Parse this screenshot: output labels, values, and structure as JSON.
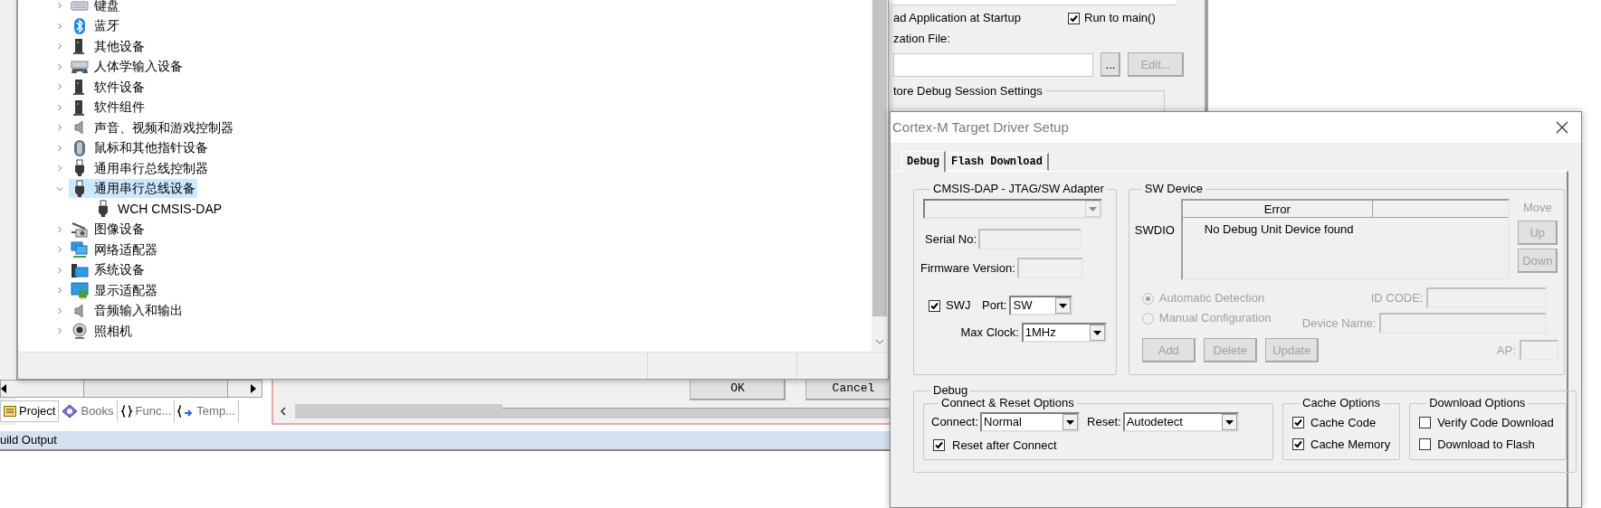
{
  "ide": {
    "project_tabs": [
      {
        "label": "Project",
        "selected": true
      },
      {
        "label": "Books",
        "selected": false
      },
      {
        "label": "Func...",
        "selected": false
      },
      {
        "label": "Temp...",
        "selected": false
      }
    ],
    "build_output": {
      "title": "uild Output"
    }
  },
  "options_dialog": {
    "load_application": {
      "label": "ad Application at Startup"
    },
    "run_to_main": {
      "label": "Run to main()",
      "checked": true
    },
    "init_file": {
      "label": "zation File:"
    },
    "browse_button": {
      "label": "..."
    },
    "edit_button": {
      "label": "Edit...",
      "disabled": true
    },
    "restore_group": {
      "title": "tore Debug Session Settings"
    },
    "buttons": [
      {
        "label": "OK"
      },
      {
        "label": "Cancel"
      }
    ]
  },
  "device_manager": {
    "tree": [
      {
        "label": "键盘",
        "expanded": false,
        "selected": false
      },
      {
        "label": "蓝牙",
        "expanded": false,
        "selected": false
      },
      {
        "label": "其他设备",
        "expanded": false,
        "selected": false
      },
      {
        "label": "人体学输入设备",
        "expanded": false,
        "selected": false
      },
      {
        "label": "软件设备",
        "expanded": false,
        "selected": false
      },
      {
        "label": "软件组件",
        "expanded": false,
        "selected": false
      },
      {
        "label": "声音、视频和游戏控制器",
        "expanded": false,
        "selected": false
      },
      {
        "label": "鼠标和其他指针设备",
        "expanded": false,
        "selected": false
      },
      {
        "label": "通用串行总线控制器",
        "expanded": false,
        "selected": false
      },
      {
        "label": "通用串行总线设备",
        "expanded": true,
        "selected": true,
        "children": [
          {
            "label": "WCH CMSIS-DAP",
            "selected": false
          }
        ]
      },
      {
        "label": "图像设备",
        "expanded": false,
        "selected": false
      },
      {
        "label": "网络适配器",
        "expanded": false,
        "selected": false
      },
      {
        "label": "系统设备",
        "expanded": false,
        "selected": false
      },
      {
        "label": "显示适配器",
        "expanded": false,
        "selected": false
      },
      {
        "label": "音频输入和输出",
        "expanded": false,
        "selected": false
      },
      {
        "label": "照相机",
        "expanded": false,
        "selected": false
      }
    ]
  },
  "cortex_dialog": {
    "title": "Cortex-M Target Driver Setup",
    "tabs": [
      {
        "label": "Debug",
        "selected": true
      },
      {
        "label": "Flash Download",
        "selected": false
      }
    ],
    "adapter_group": {
      "title": "CMSIS-DAP - JTAG/SW Adapter",
      "adapter_select": {
        "disabled": true
      },
      "serial_no": {
        "label": "Serial No:"
      },
      "firmware_version": {
        "label": "Firmware Version:"
      },
      "swj": {
        "label": "SWJ",
        "checked": true
      },
      "port": {
        "label": "Port:",
        "value": "SW"
      },
      "max_clock": {
        "label": "Max Clock:",
        "value": "1MHz"
      }
    },
    "sw_device_group": {
      "title": "SW Device",
      "row_label": "SWDIO",
      "table": {
        "columns": [
          "Error"
        ],
        "rows": [
          [
            "No Debug Unit Device found"
          ]
        ]
      },
      "move": {
        "label": "Move",
        "buttons": [
          {
            "label": "Up",
            "disabled": true
          },
          {
            "label": "Down",
            "disabled": true
          }
        ]
      },
      "detection": [
        {
          "label": "Automatic Detection",
          "selected": true,
          "disabled": true
        },
        {
          "label": "Manual Configuration",
          "selected": false,
          "disabled": true
        }
      ],
      "id_code": {
        "label": "ID CODE:"
      },
      "device_name": {
        "label": "Device Name:"
      },
      "actions": [
        {
          "label": "Add",
          "disabled": true
        },
        {
          "label": "Delete",
          "disabled": true
        },
        {
          "label": "Update",
          "disabled": true
        }
      ],
      "ap": {
        "label": "AP:"
      }
    },
    "debug_group": {
      "title": "Debug",
      "connect_reset": {
        "title": "Connect & Reset Options",
        "connect": {
          "label": "Connect:",
          "value": "Normal"
        },
        "reset": {
          "label": "Reset:",
          "value": "Autodetect"
        },
        "reset_after_connect": {
          "label": "Reset after Connect",
          "checked": true
        }
      },
      "cache": {
        "title": "Cache Options",
        "options": [
          {
            "label": "Cache Code",
            "checked": true
          },
          {
            "label": "Cache Memory",
            "checked": true
          }
        ]
      },
      "download": {
        "title": "Download Options",
        "options": [
          {
            "label": "Verify Code Download",
            "checked": false
          },
          {
            "label": "Download to Flash",
            "checked": false
          }
        ]
      }
    }
  }
}
